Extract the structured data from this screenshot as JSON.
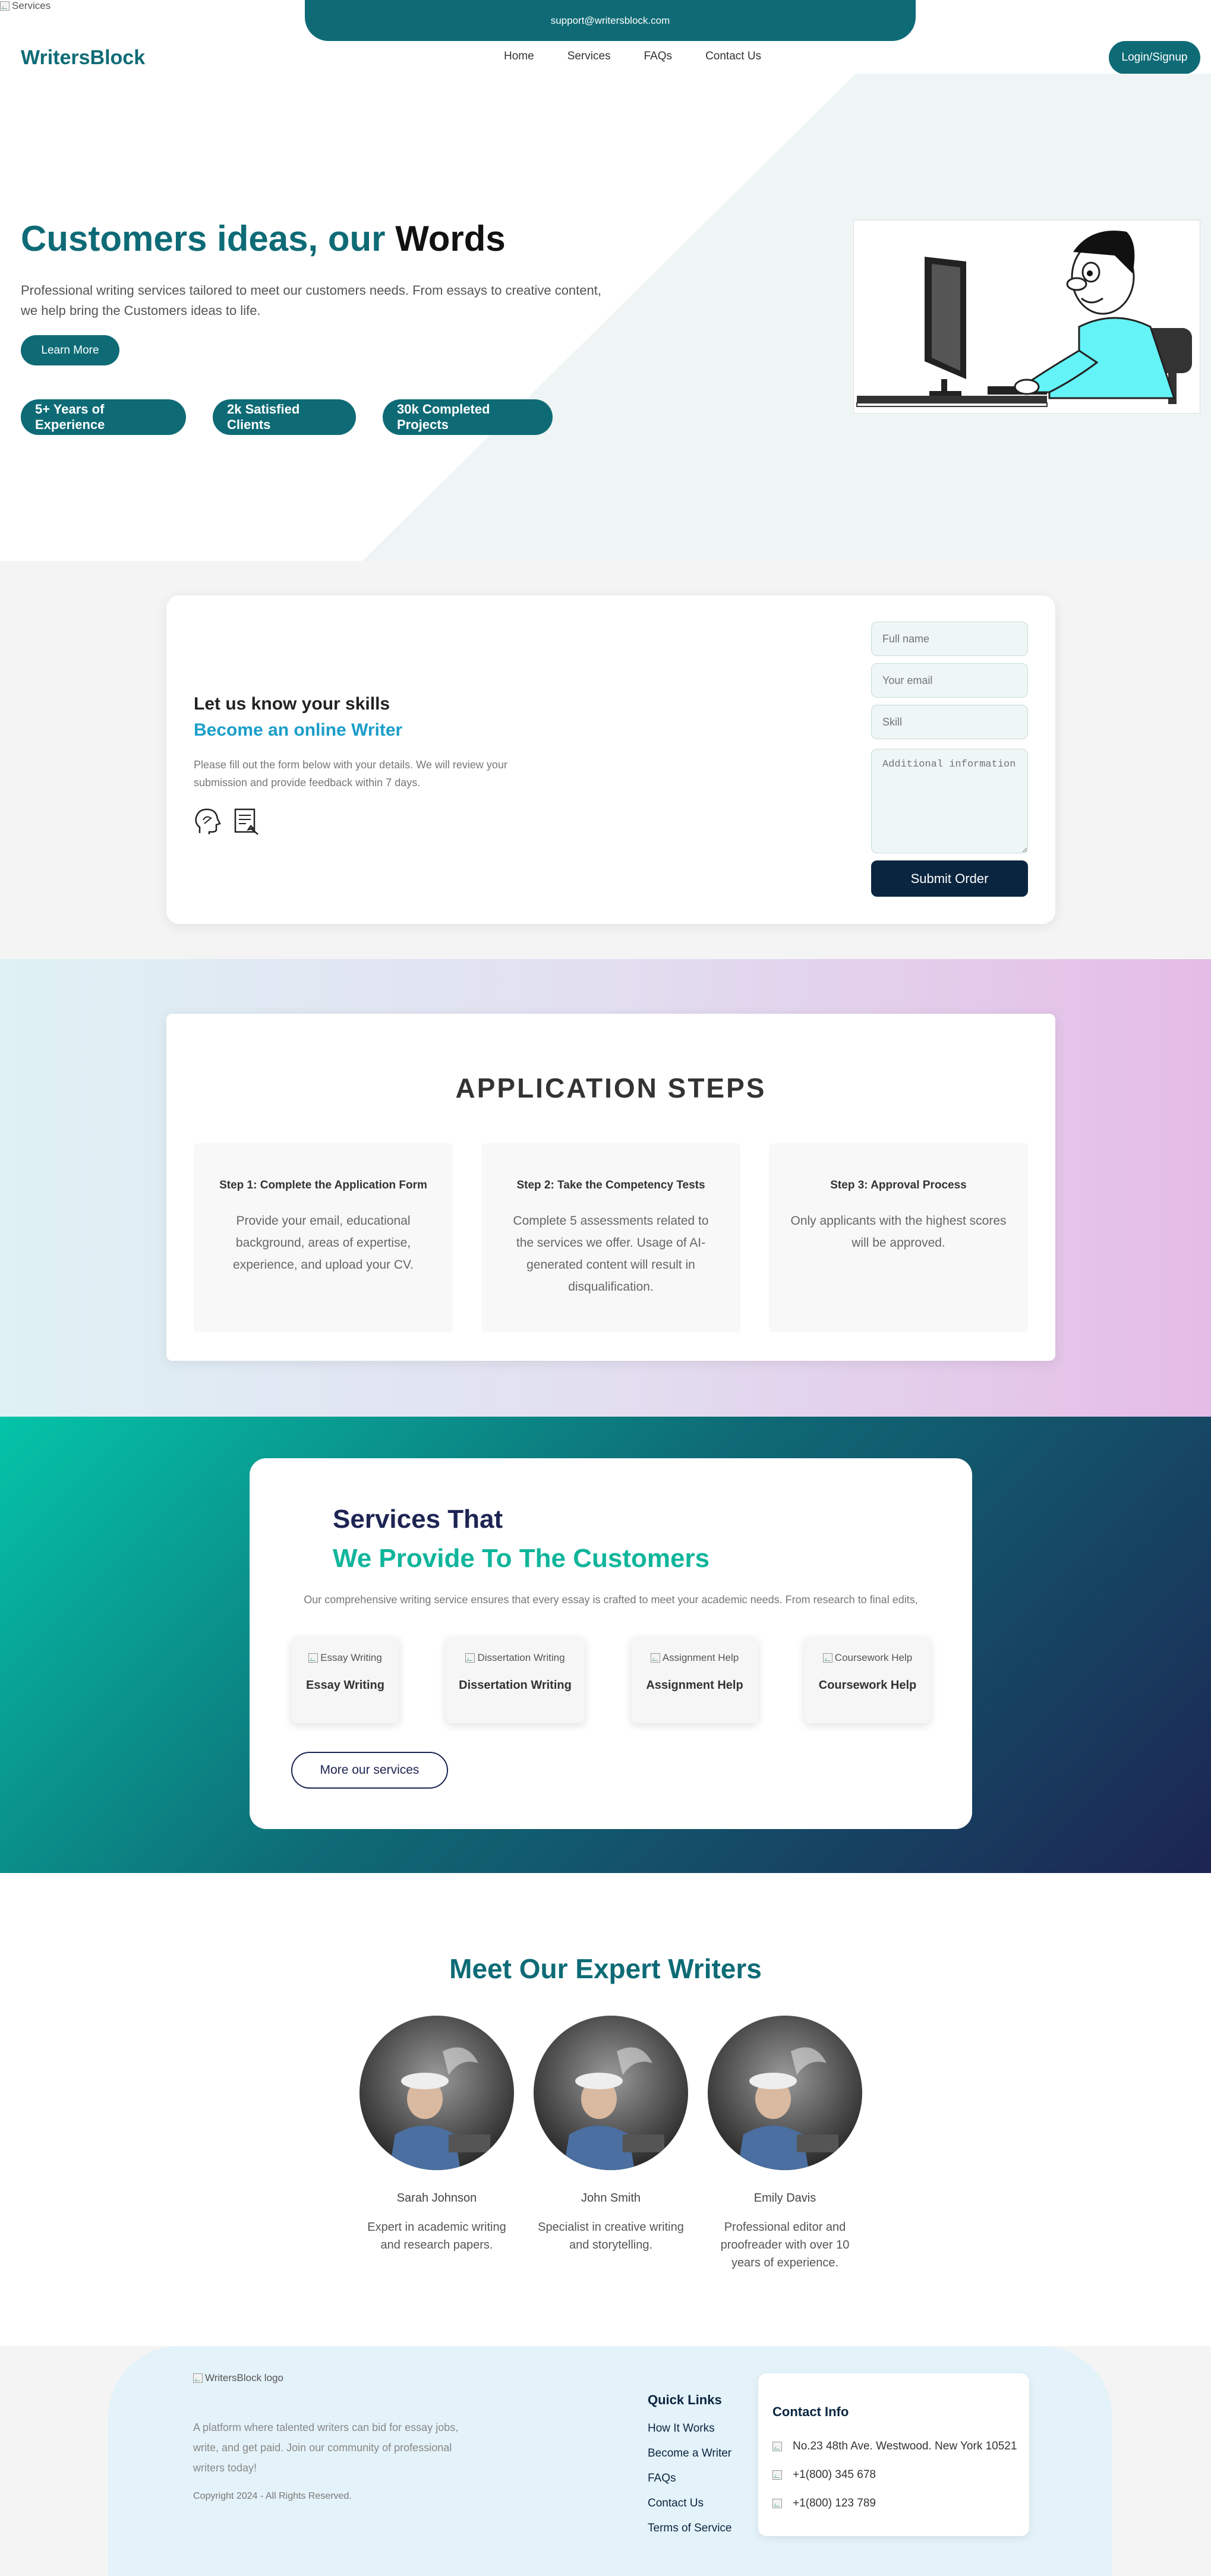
{
  "top_broken_alt": "Services",
  "topbar": {
    "email": "support@writersblock.com"
  },
  "header": {
    "logo": "WritersBlock",
    "nav": [
      "Home",
      "Services",
      "FAQs",
      "Contact Us"
    ],
    "login": "Login/Signup"
  },
  "hero": {
    "title_accent": "Customers ideas, our",
    "title_dark": "Words",
    "description": "Professional writing services tailored to meet our customers needs. From essays to creative content, we help bring the Customers ideas to life.",
    "cta": "Learn More",
    "stats": [
      "5+ Years of Experience",
      "2k Satisfied Clients",
      "30k Completed Projects"
    ]
  },
  "skills": {
    "heading": "Let us know your skills",
    "subheading": "Become an online Writer",
    "description": "Please fill out the form below with your details. We will review your submission and provide feedback within 7 days.",
    "icons": [
      "brain-icon",
      "document-icon"
    ],
    "form": {
      "full_name_placeholder": "Full name",
      "email_placeholder": "Your email",
      "skill_placeholder": "Skill",
      "info_placeholder": "Additional information",
      "submit": "Submit Order"
    }
  },
  "steps": {
    "title": "APPLICATION STEPS",
    "items": [
      {
        "title": "Step 1: Complete the Application Form",
        "text": "Provide your email, educational background, areas of expertise, experience, and upload your CV."
      },
      {
        "title": "Step 2: Take the Competency Tests",
        "text": "Complete 5 assessments related to the services we offer. Usage of AI-generated content will result in disqualification."
      },
      {
        "title": "Step 3: Approval Process",
        "text": "Only applicants with the highest scores will be approved."
      }
    ]
  },
  "services": {
    "heading1": "Services That",
    "heading2": "We Provide To The Customers",
    "description": "Our comprehensive writing service ensures that every essay is crafted to meet your academic needs. From research to final edits,",
    "items": [
      {
        "alt": "Essay Writing",
        "label": "Essay Writing"
      },
      {
        "alt": "Dissertation Writing",
        "label": "Dissertation Writing"
      },
      {
        "alt": "Assignment Help",
        "label": "Assignment Help"
      },
      {
        "alt": "Coursework Help",
        "label": "Coursework Help"
      }
    ],
    "more": "More our services"
  },
  "writers": {
    "title": "Meet Our Expert Writers",
    "items": [
      {
        "name": "Sarah Johnson",
        "desc": "Expert in academic writing and research papers."
      },
      {
        "name": "John Smith",
        "desc": "Specialist in creative writing and storytelling."
      },
      {
        "name": "Emily Davis",
        "desc": "Professional editor and proofreader with over 10 years of experience."
      }
    ]
  },
  "footer": {
    "logo_alt": "WritersBlock logo",
    "description": "A platform where talented writers can bid for essay jobs, write, and get paid. Join our community of professional writers today!",
    "copyright": "Copyright 2024 - All Rights Reserved.",
    "quick_links_title": "Quick Links",
    "quick_links": [
      "How It Works",
      "Become a Writer",
      "FAQs",
      "Contact Us",
      "Terms of Service"
    ],
    "contact_title": "Contact Info",
    "contact": [
      "No.23 48th Ave. Westwood. New York 10521",
      "+1(800) 345 678",
      "+1(800) 123 789"
    ]
  },
  "colors": {
    "primary": "#0e6b76",
    "accent_blue": "#1a9ec9",
    "accent_green": "#0fb59b",
    "navy": "#0a2540",
    "indigo": "#1d2452"
  }
}
